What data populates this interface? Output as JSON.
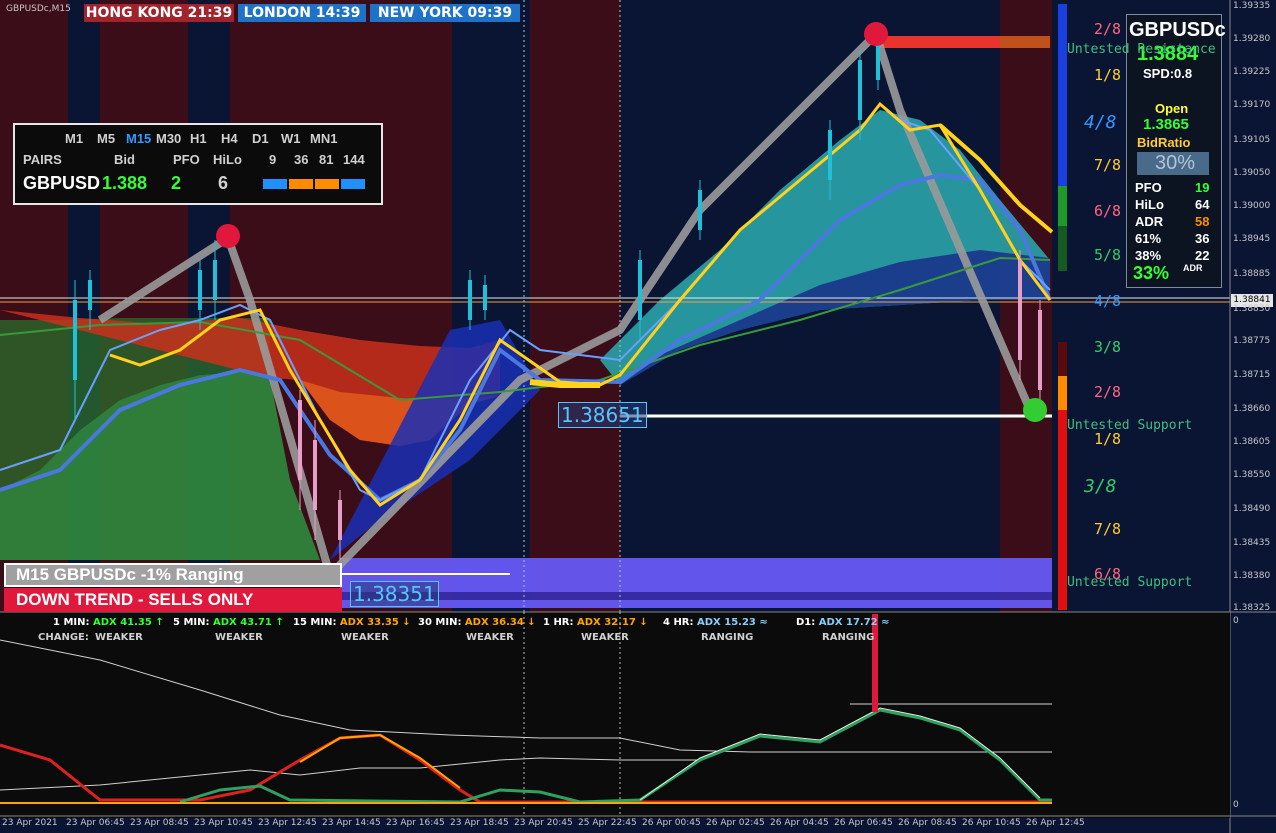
{
  "window": {
    "title": "GBPUSDc,M15"
  },
  "sessions": [
    {
      "label": "HONG KONG 21:39",
      "color": "#a1232b"
    },
    {
      "label": "LONDON 14:39",
      "color": "#1e73c8"
    },
    {
      "label": "NEW YORK 09:39",
      "color": "#1e73c8"
    }
  ],
  "tf_panel": {
    "timeframes": [
      "M1",
      "M5",
      "M15",
      "M30",
      "H1",
      "H4",
      "D1",
      "W1",
      "MN1"
    ],
    "active_timeframe": "M15",
    "header": [
      "PAIRS",
      "Bid",
      "PFO",
      "HiLo",
      "9",
      "36",
      "81",
      "144"
    ],
    "row": {
      "pair": "GBPUSD",
      "bid": "1.388",
      "pfo": "2",
      "hilo": "6"
    },
    "bars": [
      "#1e90ff",
      "#ff8c00",
      "#ff8c00",
      "#1e90ff"
    ]
  },
  "info_panel": {
    "symbol": "GBPUSDc",
    "price": "1.3884",
    "spread": "SPD:0.8",
    "open_label": "Open",
    "open_value": "1.3865",
    "bidratio_label": "BidRatio",
    "bidratio_value": "30%",
    "stats": [
      {
        "label": "PFO",
        "value": "19",
        "color": "#33ff33"
      },
      {
        "label": "HiLo",
        "value": "64",
        "color": "#ffffff"
      },
      {
        "label": "ADR",
        "value": "58",
        "color": "#ff8c00"
      },
      {
        "label": "61%",
        "value": "36",
        "color": "#ffffff"
      },
      {
        "label": "38%",
        "value": "22",
        "color": "#ffffff"
      }
    ],
    "adr_percent": "33%",
    "adr_label": "ADR"
  },
  "price_labels": {
    "mid": "1.38651",
    "low": "1.38351",
    "current": "1.38841"
  },
  "fib_labels": [
    {
      "text": "2/8",
      "color": "#ff6680"
    },
    {
      "text": "1/8",
      "color": "#ffcc33"
    },
    {
      "text": "4/8",
      "color": "#3399ff"
    },
    {
      "text": "7/8",
      "color": "#ffcc33"
    },
    {
      "text": "6/8",
      "color": "#ff6680"
    },
    {
      "text": "5/8",
      "color": "#33cc66"
    },
    {
      "text": "4/8",
      "color": "#3399ff"
    },
    {
      "text": "3/8",
      "color": "#33cc66"
    },
    {
      "text": "2/8",
      "color": "#ff6680"
    },
    {
      "text": "1/8",
      "color": "#ffcc33"
    },
    {
      "text": "3/8",
      "color": "#33cc66"
    },
    {
      "text": "7/8",
      "color": "#ffcc33"
    },
    {
      "text": "6/8",
      "color": "#ff6680"
    }
  ],
  "zones": {
    "resistance": "Untested Resistance",
    "support1": "Untested Support",
    "support2": "Untested Support"
  },
  "status": {
    "line1": "M15 GBPUSDc -1% Ranging",
    "line2": "DOWN TREND - SELLS ONLY"
  },
  "y_axis": [
    "1.39335",
    "1.39280",
    "1.39225",
    "1.39170",
    "1.39105",
    "1.39050",
    "1.39000",
    "1.38945",
    "1.38885",
    "1.38830",
    "1.38775",
    "1.38715",
    "1.38660",
    "1.38605",
    "1.38550",
    "1.38490",
    "1.38435",
    "1.38380",
    "1.38325"
  ],
  "x_axis": [
    "23 Apr 2021",
    "23 Apr 06:45",
    "23 Apr 08:45",
    "23 Apr 10:45",
    "23 Apr 12:45",
    "23 Apr 14:45",
    "23 Apr 16:45",
    "23 Apr 18:45",
    "23 Apr 20:45",
    "25 Apr 22:45",
    "26 Apr 00:45",
    "26 Apr 02:45",
    "26 Apr 04:45",
    "26 Apr 06:45",
    "26 Apr 08:45",
    "26 Apr 10:45",
    "26 Apr 12:45"
  ],
  "adx": {
    "change_label": "CHANGE:",
    "items": [
      {
        "tf": "1 MIN:",
        "value": "ADX 41.35",
        "arrow": "↑",
        "state": "WEAKER",
        "color": "#33ff33"
      },
      {
        "tf": "5 MIN:",
        "value": "ADX 43.71",
        "arrow": "↑",
        "state": "WEAKER",
        "color": "#33ff33"
      },
      {
        "tf": "15 MIN:",
        "value": "ADX 33.35",
        "arrow": "↓",
        "state": "WEAKER",
        "color": "#ffa500"
      },
      {
        "tf": "30 MIN:",
        "value": "ADX 36.34",
        "arrow": "↓",
        "state": "WEAKER",
        "color": "#ffa500"
      },
      {
        "tf": "1 HR:",
        "value": "ADX 32.17",
        "arrow": "↓",
        "state": "WEAKER",
        "color": "#ffa500"
      },
      {
        "tf": "4 HR:",
        "value": "ADX 15.23",
        "arrow": "≈",
        "state": "RANGING",
        "color": "#87cefa"
      },
      {
        "tf": "D1:",
        "value": "ADX 17.72",
        "arrow": "≈",
        "state": "RANGING",
        "color": "#87cefa"
      }
    ],
    "scale_top": "0",
    "scale_bottom": "0"
  },
  "colors": {
    "accent": "#53c6ff",
    "bull": "#22c0d8",
    "bear": "#e6a0c8",
    "pivot_high": "#e0183c",
    "pivot_low": "#33cc33"
  }
}
